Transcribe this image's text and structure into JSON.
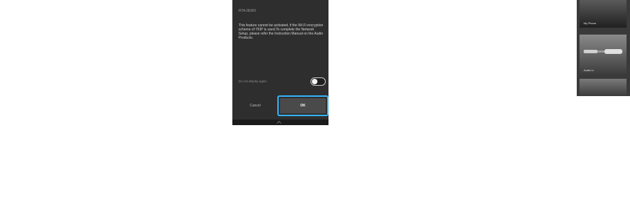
{
  "dialog": {
    "subtitle": "RTA-0EMO",
    "message": "This feature cannot be activated, if the Wi-Fi encryption scheme of TKIP is used.To complete the Network Setup, please refer the Instruction Manual on the Audio Products.",
    "toggle_label": "Do not display again",
    "toggle_on": false,
    "cancel_label": "Cancel",
    "ok_label": "OK"
  },
  "source_list": {
    "items": [
      {
        "label": "My Phone"
      },
      {
        "label": "Audio in"
      }
    ]
  },
  "colors": {
    "highlight": "#35b6ff",
    "dialog_bg": "#2e2e2e"
  },
  "icons": {
    "chevron": "chevron-up-icon"
  }
}
